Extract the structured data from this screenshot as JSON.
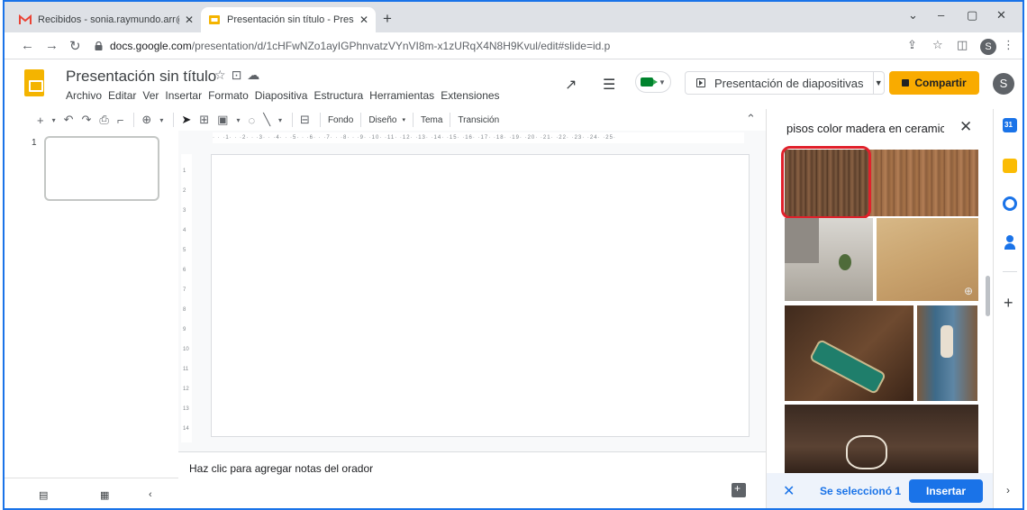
{
  "browser": {
    "tabs": [
      {
        "title": "Recibidos - sonia.raymundo.arr@",
        "active": false,
        "favicon": "gmail-icon"
      },
      {
        "title": "Presentación sin título - Presenta",
        "active": true,
        "favicon": "slides-icon"
      }
    ],
    "new_tab": "+",
    "window_controls": [
      "⌄",
      "–",
      "▢",
      "✕"
    ],
    "url_host": "docs.google.com",
    "url_path": "/presentation/d/1cHFwNZo1ayIGPhnvatzVYnVI8m-x1zURqX4N8H9Kvul/edit#slide=id.p",
    "profile_letter": "S"
  },
  "app": {
    "title": "Presentación sin título",
    "menu": [
      "Archivo",
      "Editar",
      "Ver",
      "Insertar",
      "Formato",
      "Diapositiva",
      "Estructura",
      "Herramientas",
      "Extensiones"
    ],
    "present_label": "Presentación de diapositivas",
    "share_label": "Compartir",
    "avatar_letter": "S",
    "accent_share": "#f9ab00",
    "accent_primary": "#1a73e8"
  },
  "toolbar": {
    "fondo": "Fondo",
    "diseno": "Diseño",
    "tema": "Tema",
    "transicion": "Transición"
  },
  "filmstrip": {
    "slide_number": "1"
  },
  "ruler": {
    "h_ticks": "· · ·1· · ·2· · ·3· · ·4· · ·5· · ·6· · ·7· · ·8· · ·9· ·10· ·11· ·12· ·13· ·14· ·15· ·16· ·17· ·18· ·19· ·20· ·21· ·22· ·23· ·24· ·25·",
    "v_ticks": [
      "1",
      "2",
      "3",
      "4",
      "5",
      "6",
      "7",
      "8",
      "9",
      "10",
      "11",
      "12",
      "13",
      "14"
    ]
  },
  "notes": {
    "placeholder": "Haz clic para agregar notas del orador"
  },
  "image_panel": {
    "search_query": "pisos color madera en ceramica",
    "selected_text": "Se seleccionó 1",
    "insert_label": "Insertar"
  }
}
